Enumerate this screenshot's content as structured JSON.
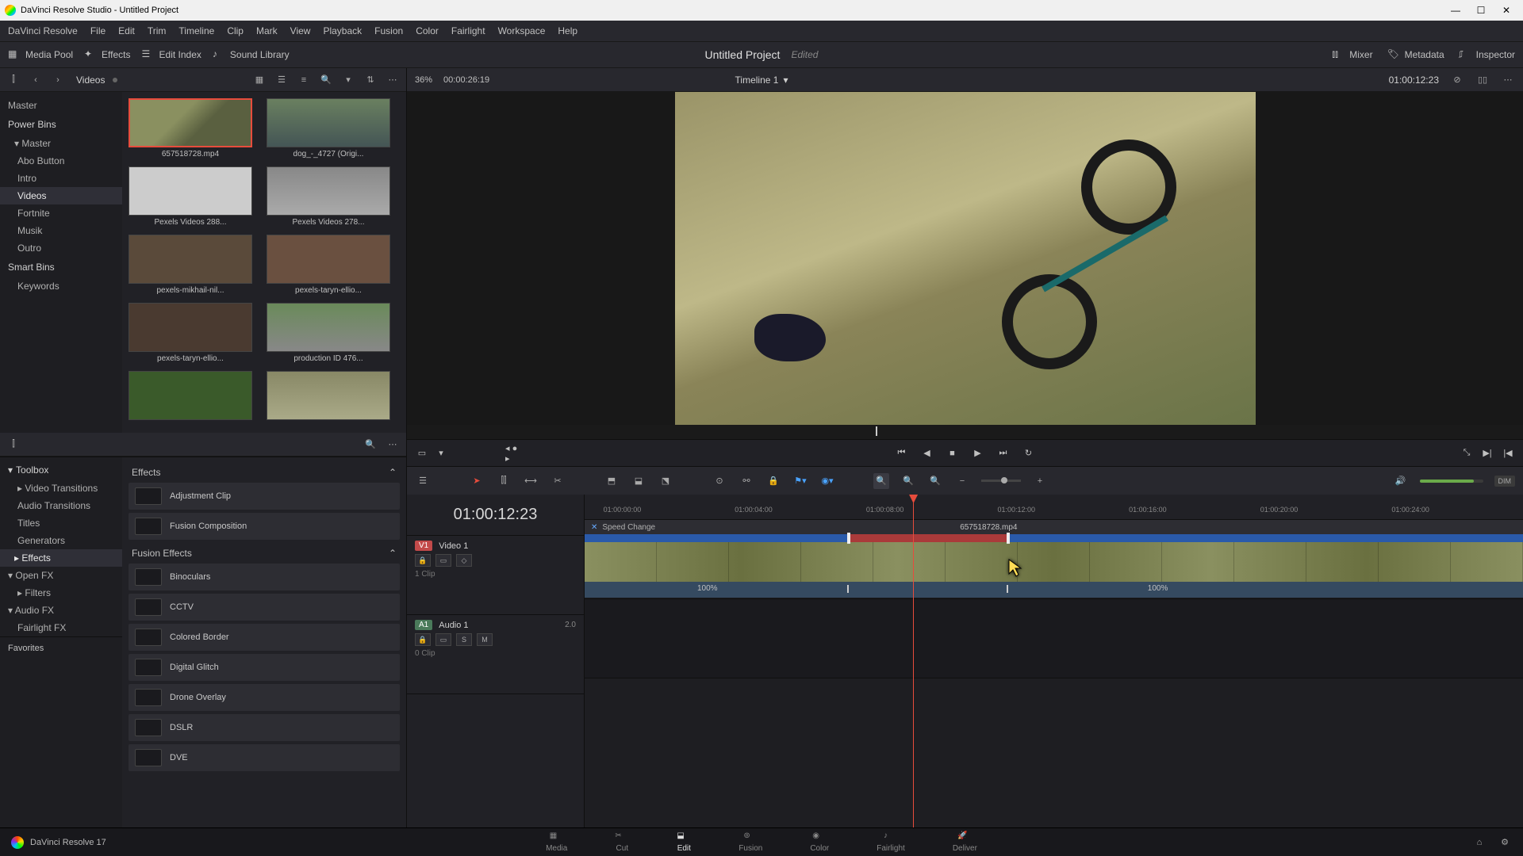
{
  "window": {
    "title": "DaVinci Resolve Studio - Untitled Project"
  },
  "menu": [
    "DaVinci Resolve",
    "File",
    "Edit",
    "Trim",
    "Timeline",
    "Clip",
    "Mark",
    "View",
    "Playback",
    "Fusion",
    "Color",
    "Fairlight",
    "Workspace",
    "Help"
  ],
  "toolbar": {
    "media_pool": "Media Pool",
    "effects": "Effects",
    "edit_index": "Edit Index",
    "sound_library": "Sound Library",
    "mixer": "Mixer",
    "metadata": "Metadata",
    "inspector": "Inspector"
  },
  "project": {
    "title": "Untitled Project",
    "status": "Edited"
  },
  "bins": {
    "current": "Videos",
    "tree_root": "Master",
    "power_bins": "Power Bins",
    "power_master": "Master",
    "items": [
      "Abo Button",
      "Intro",
      "Videos",
      "Fortnite",
      "Musik",
      "Outro"
    ],
    "smart_bins": "Smart Bins",
    "keywords": "Keywords"
  },
  "clips": [
    {
      "name": "657518728.mp4",
      "sel": true,
      "cls": "thumb1"
    },
    {
      "name": "dog_-_4727 (Origi...",
      "cls": "thumb2"
    },
    {
      "name": "Pexels Videos 288...",
      "cls": "thumb3"
    },
    {
      "name": "Pexels Videos 278...",
      "cls": "thumb4"
    },
    {
      "name": "pexels-mikhail-nil...",
      "cls": "thumb5"
    },
    {
      "name": "pexels-taryn-ellio...",
      "cls": "thumb6"
    },
    {
      "name": "pexels-taryn-ellio...",
      "cls": "thumb7"
    },
    {
      "name": "production ID 476...",
      "cls": "thumb8"
    },
    {
      "name": "",
      "cls": "thumb9"
    },
    {
      "name": "",
      "cls": "thumb10"
    }
  ],
  "fx_tree": {
    "toolbox": "Toolbox",
    "video_transitions": "Video Transitions",
    "audio_transitions": "Audio Transitions",
    "titles": "Titles",
    "generators": "Generators",
    "effects": "Effects",
    "openfx": "Open FX",
    "filters": "Filters",
    "audiofx": "Audio FX",
    "fairlightfx": "Fairlight FX",
    "favorites": "Favorites"
  },
  "fx_list": {
    "header": "Effects",
    "items1": [
      "Adjustment Clip",
      "Fusion Composition"
    ],
    "section2": "Fusion Effects",
    "items2": [
      "Binoculars",
      "CCTV",
      "Colored Border",
      "Digital Glitch",
      "Drone Overlay",
      "DSLR",
      "DVE"
    ]
  },
  "viewer": {
    "zoom": "36%",
    "src_tc": "00:00:26:19",
    "timeline_name": "Timeline 1",
    "rec_tc": "01:00:12:23"
  },
  "timeline": {
    "tc_big": "01:00:12:23",
    "video_track": {
      "badge": "V1",
      "name": "Video 1",
      "clips": "1 Clip"
    },
    "audio_track": {
      "badge": "A1",
      "name": "Audio 1",
      "meter": "2.0",
      "clips": "0 Clip"
    },
    "speed_label": "Speed Change",
    "clip_name": "657518728.mp4",
    "ticks": [
      "01:00:00:00",
      "01:00:04:00",
      "01:00:08:00",
      "01:00:12:00",
      "01:00:16:00",
      "01:00:20:00",
      "01:00:24:00"
    ],
    "pct_left": "100%",
    "pct_right": "100%",
    "dim": "DIM"
  },
  "pages": [
    "Media",
    "Cut",
    "Edit",
    "Fusion",
    "Color",
    "Fairlight",
    "Deliver"
  ],
  "version": "DaVinci Resolve 17",
  "track_buttons": {
    "s": "S",
    "m": "M"
  }
}
